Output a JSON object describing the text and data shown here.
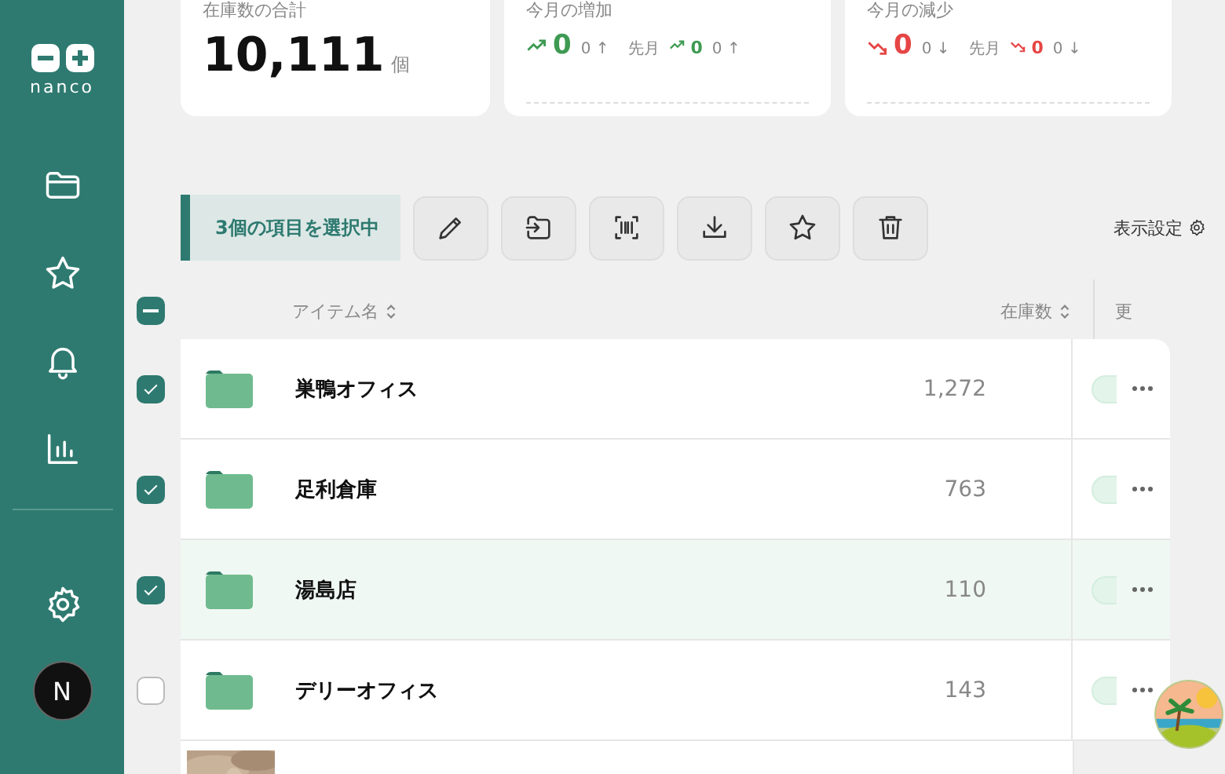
{
  "sidebar": {
    "logo": "nanco",
    "avatar": "N"
  },
  "stats": [
    {
      "kind": "total",
      "title": "在庫数の合計",
      "value": "10,111",
      "unit": "個"
    },
    {
      "kind": "increase",
      "title": "今月の増加",
      "value": "0",
      "change": "0 ↑",
      "prev_label": "先月",
      "prev_value": "0",
      "prev_change": "0 ↑"
    },
    {
      "kind": "decrease",
      "title": "今月の減少",
      "value": "0",
      "change": "0 ↓",
      "prev_label": "先月",
      "prev_value": "0",
      "prev_change": "0 ↓"
    }
  ],
  "toolbar": {
    "selection": "3個の項目を選択中",
    "settings": "表示設定"
  },
  "table": {
    "select_all": {
      "checked": true,
      "partial": true
    },
    "columns": [
      "アイテム名",
      "在庫数",
      "更"
    ],
    "rows": [
      {
        "kind": "folder",
        "name": "巣鴨オフィス",
        "stock": "1,272",
        "checked": true,
        "highlighted": false
      },
      {
        "kind": "folder",
        "name": "足利倉庫",
        "stock": "763",
        "checked": true,
        "highlighted": false
      },
      {
        "kind": "folder",
        "name": "湯島店",
        "stock": "110",
        "checked": true,
        "highlighted": true
      },
      {
        "kind": "folder",
        "name": "デリーオフィス",
        "stock": "143",
        "checked": false,
        "highlighted": false
      },
      {
        "kind": "picture"
      }
    ]
  }
}
